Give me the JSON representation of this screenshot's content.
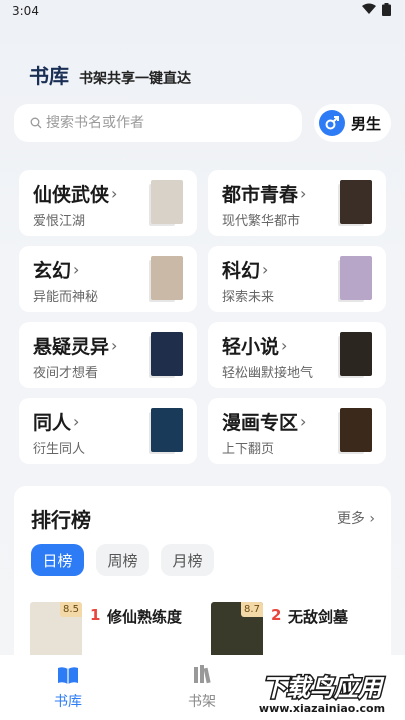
{
  "status_bar": {
    "time": "3:04"
  },
  "header": {
    "title": "书库",
    "subtitle": "书架共享一键直达"
  },
  "search": {
    "placeholder": "搜索书名或作者"
  },
  "gender": {
    "label": "男生"
  },
  "categories": [
    {
      "title": "仙侠武侠",
      "sub": "爱恨江湖",
      "cover_color": "#d9d2c8"
    },
    {
      "title": "都市青春",
      "sub": "现代繁华都市",
      "cover_color": "#3a2e26"
    },
    {
      "title": "玄幻",
      "sub": "异能而神秘",
      "cover_color": "#c9b9a6"
    },
    {
      "title": "科幻",
      "sub": "探索未来",
      "cover_color": "#b8a6c8"
    },
    {
      "title": "悬疑灵异",
      "sub": "夜间才想看",
      "cover_color": "#1f2e4a"
    },
    {
      "title": "轻小说",
      "sub": "轻松幽默接地气",
      "cover_color": "#2b2620"
    },
    {
      "title": "同人",
      "sub": "衍生同人",
      "cover_color": "#1a3a5a"
    },
    {
      "title": "漫画专区",
      "sub": "上下翻页",
      "cover_color": "#3b2a1c"
    }
  ],
  "ranking": {
    "title": "排行榜",
    "more": "更多",
    "tabs": [
      "日榜",
      "周榜",
      "月榜"
    ],
    "active_tab": "日榜",
    "items": [
      {
        "rank": "1",
        "name": "修仙熟练度",
        "score": "8.5",
        "cover_color": "#e8e2d6"
      },
      {
        "rank": "2",
        "name": "无敌剑墓",
        "score": "8.7",
        "cover_color": "#3a3a2a"
      }
    ]
  },
  "bottom_nav": [
    {
      "label": "书库",
      "active": true
    },
    {
      "label": "书架",
      "active": false
    }
  ],
  "watermark": {
    "line1": "下载鸟应用",
    "line2": "www.xiazainiao.com"
  },
  "colors": {
    "accent": "#2d7cf6",
    "rank_num": "#e8453c"
  }
}
